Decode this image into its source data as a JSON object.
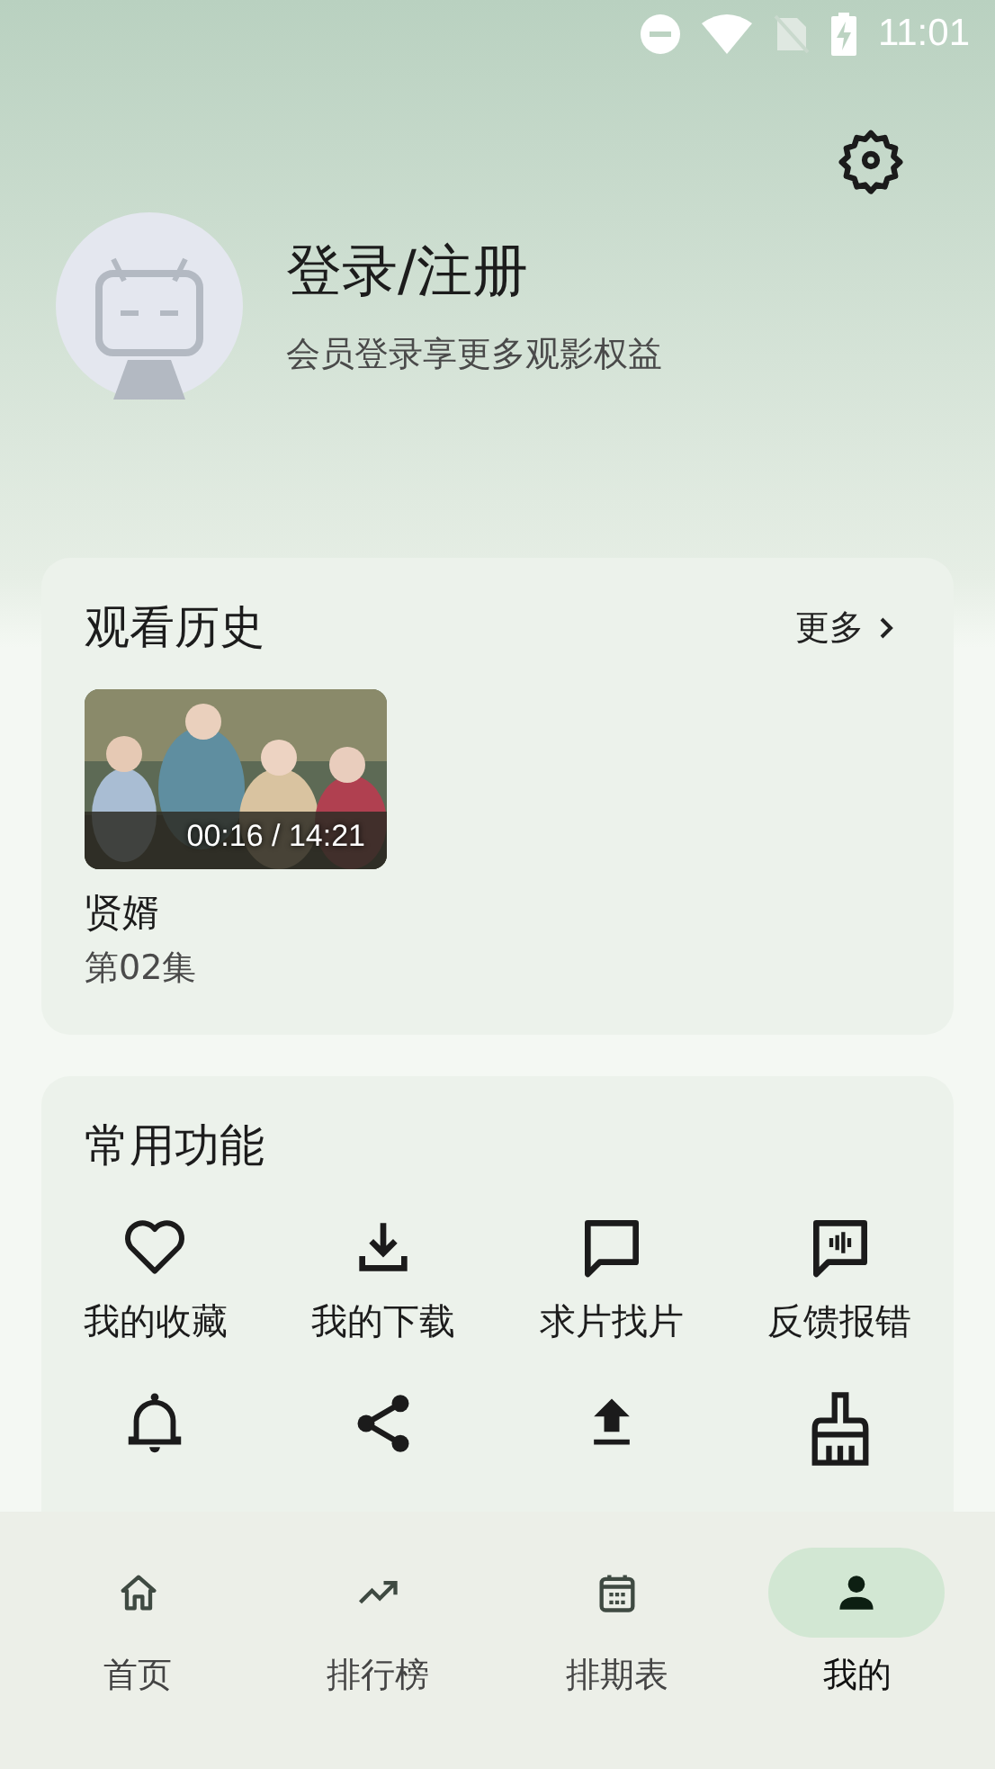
{
  "status_bar": {
    "time": "11:01"
  },
  "profile": {
    "title": "登录/注册",
    "subtitle": "会员登录享更多观影权益"
  },
  "history": {
    "title": "观看历史",
    "more": "更多",
    "items": [
      {
        "progress": "00:16 / 14:21",
        "name": "贤婿",
        "episode": "第02集"
      }
    ]
  },
  "functions": {
    "title": "常用功能",
    "items": [
      {
        "label": "我的收藏"
      },
      {
        "label": "我的下载"
      },
      {
        "label": "求片找片"
      },
      {
        "label": "反馈报错"
      }
    ]
  },
  "nav": [
    {
      "label": "首页",
      "selected": false
    },
    {
      "label": "排行榜",
      "selected": false
    },
    {
      "label": "排期表",
      "selected": false
    },
    {
      "label": "我的",
      "selected": true
    }
  ]
}
